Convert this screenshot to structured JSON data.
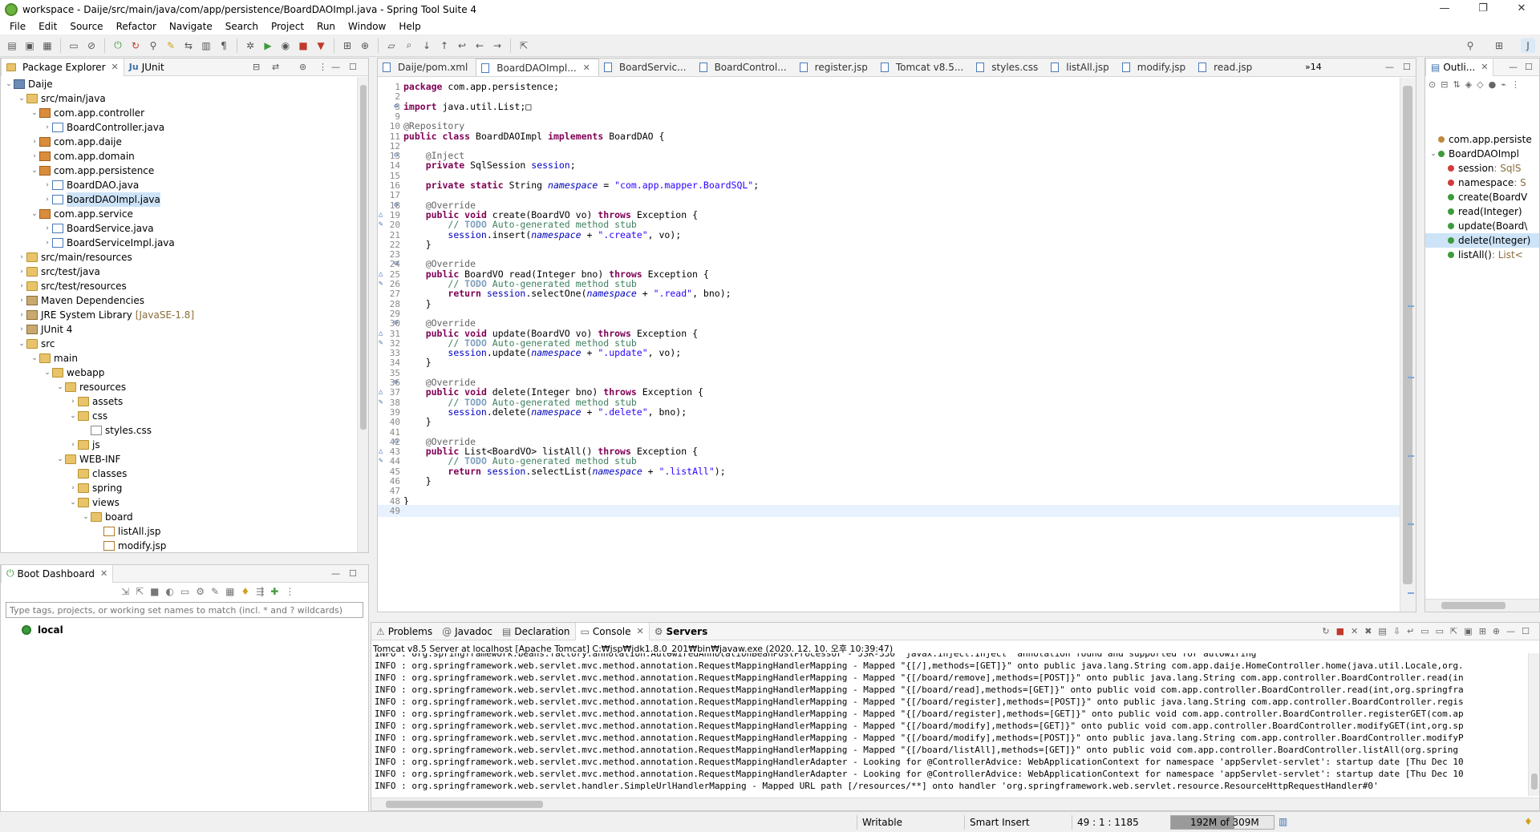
{
  "window": {
    "title": "workspace - Daije/src/main/java/com/app/persistence/BoardDAOImpl.java - Spring Tool Suite 4"
  },
  "menu": [
    "File",
    "Edit",
    "Source",
    "Refactor",
    "Navigate",
    "Search",
    "Project",
    "Run",
    "Window",
    "Help"
  ],
  "package_explorer": {
    "tab_label": "Package Explorer",
    "junit_tab": "JUnit",
    "items": [
      {
        "label": "Daije",
        "indent": 0,
        "arrow": "⌄",
        "icon": "proj"
      },
      {
        "label": "src/main/java",
        "indent": 1,
        "arrow": "⌄",
        "icon": "folder"
      },
      {
        "label": "com.app.controller",
        "indent": 2,
        "arrow": "⌄",
        "icon": "pkg"
      },
      {
        "label": "BoardController.java",
        "indent": 3,
        "arrow": "›",
        "icon": "java"
      },
      {
        "label": "com.app.daije",
        "indent": 2,
        "arrow": "›",
        "icon": "pkg"
      },
      {
        "label": "com.app.domain",
        "indent": 2,
        "arrow": "›",
        "icon": "pkg"
      },
      {
        "label": "com.app.persistence",
        "indent": 2,
        "arrow": "⌄",
        "icon": "pkg"
      },
      {
        "label": "BoardDAO.java",
        "indent": 3,
        "arrow": "›",
        "icon": "java"
      },
      {
        "label": "BoardDAOImpl.java",
        "indent": 3,
        "arrow": "›",
        "icon": "java",
        "selected": true
      },
      {
        "label": "com.app.service",
        "indent": 2,
        "arrow": "⌄",
        "icon": "pkg"
      },
      {
        "label": "BoardService.java",
        "indent": 3,
        "arrow": "›",
        "icon": "java"
      },
      {
        "label": "BoardServiceImpl.java",
        "indent": 3,
        "arrow": "›",
        "icon": "java"
      },
      {
        "label": "src/main/resources",
        "indent": 1,
        "arrow": "›",
        "icon": "folder"
      },
      {
        "label": "src/test/java",
        "indent": 1,
        "arrow": "›",
        "icon": "folder"
      },
      {
        "label": "src/test/resources",
        "indent": 1,
        "arrow": "›",
        "icon": "folder"
      },
      {
        "label": "Maven Dependencies",
        "indent": 1,
        "arrow": "›",
        "icon": "jar"
      },
      {
        "label": "JRE System Library",
        "decoration": "[JavaSE-1.8]",
        "indent": 1,
        "arrow": "›",
        "icon": "jar"
      },
      {
        "label": "JUnit 4",
        "indent": 1,
        "arrow": "›",
        "icon": "jar"
      },
      {
        "label": "src",
        "indent": 1,
        "arrow": "⌄",
        "icon": "folder"
      },
      {
        "label": "main",
        "indent": 2,
        "arrow": "⌄",
        "icon": "folder"
      },
      {
        "label": "webapp",
        "indent": 3,
        "arrow": "⌄",
        "icon": "folder"
      },
      {
        "label": "resources",
        "indent": 4,
        "arrow": "⌄",
        "icon": "folder"
      },
      {
        "label": "assets",
        "indent": 5,
        "arrow": "›",
        "icon": "folder"
      },
      {
        "label": "css",
        "indent": 5,
        "arrow": "⌄",
        "icon": "folder"
      },
      {
        "label": "styles.css",
        "indent": 6,
        "arrow": "",
        "icon": "css"
      },
      {
        "label": "js",
        "indent": 5,
        "arrow": "›",
        "icon": "folder"
      },
      {
        "label": "WEB-INF",
        "indent": 4,
        "arrow": "⌄",
        "icon": "folder"
      },
      {
        "label": "classes",
        "indent": 5,
        "arrow": "",
        "icon": "folder"
      },
      {
        "label": "spring",
        "indent": 5,
        "arrow": "›",
        "icon": "folder"
      },
      {
        "label": "views",
        "indent": 5,
        "arrow": "⌄",
        "icon": "folder"
      },
      {
        "label": "board",
        "indent": 6,
        "arrow": "⌄",
        "icon": "folder"
      },
      {
        "label": "listAll.jsp",
        "indent": 7,
        "arrow": "",
        "icon": "jsp"
      },
      {
        "label": "modify.jsp",
        "indent": 7,
        "arrow": "",
        "icon": "jsp"
      }
    ]
  },
  "editor": {
    "tabs": [
      {
        "label": "Daije/pom.xml",
        "active": false
      },
      {
        "label": "BoardDAOImpl...",
        "active": true
      },
      {
        "label": "BoardServic...",
        "active": false
      },
      {
        "label": "BoardControl...",
        "active": false
      },
      {
        "label": "register.jsp",
        "active": false
      },
      {
        "label": "Tomcat v8.5...",
        "active": false
      },
      {
        "label": "styles.css",
        "active": false
      },
      {
        "label": "listAll.jsp",
        "active": false
      },
      {
        "label": "modify.jsp",
        "active": false
      },
      {
        "label": "read.jsp",
        "active": false
      }
    ],
    "overflow": "»14",
    "lines": [
      {
        "n": "1",
        "html": "<span class='kw'>package</span> com.app.persistence;"
      },
      {
        "n": "2",
        "html": ""
      },
      {
        "n": "3",
        "html": "<span class='kw'>import</span> java.util.List;&#9633;",
        "mark": "⊕"
      },
      {
        "n": "9",
        "html": ""
      },
      {
        "n": "10",
        "html": "<span class='ann'>@Repository</span>"
      },
      {
        "n": "11",
        "html": "<span class='kw'>public class</span> BoardDAOImpl <span class='kw'>implements</span> BoardDAO {"
      },
      {
        "n": "12",
        "html": ""
      },
      {
        "n": "13",
        "html": "    <span class='ann'>@Inject</span>",
        "mark": "⊖"
      },
      {
        "n": "14",
        "html": "    <span class='kw'>private</span> SqlSession <span class='fld'>session</span>;"
      },
      {
        "n": "15",
        "html": ""
      },
      {
        "n": "16",
        "html": "    <span class='kw'>private static</span> String <span class='sfld'>namespace</span> = <span class='str'>\"com.app.mapper.BoardSQL\"</span>;"
      },
      {
        "n": "17",
        "html": ""
      },
      {
        "n": "18",
        "html": "    <span class='ann'>@Override</span>",
        "mark": "⊖"
      },
      {
        "n": "19",
        "html": "    <span class='kw'>public void</span> create(BoardVO vo) <span class='kw'>throws</span> Exception {",
        "mark": "△"
      },
      {
        "n": "20",
        "html": "        <span class='cmt'>// <span class='todo'>TODO</span> Auto-generated method stub</span>",
        "mark": "✎"
      },
      {
        "n": "21",
        "html": "        <span class='fld'>session</span>.insert(<span class='sfld'>namespace</span> + <span class='str'>\".create\"</span>, vo);"
      },
      {
        "n": "22",
        "html": "    }"
      },
      {
        "n": "23",
        "html": ""
      },
      {
        "n": "24",
        "html": "    <span class='ann'>@Override</span>",
        "mark": "⊖"
      },
      {
        "n": "25",
        "html": "    <span class='kw'>public</span> BoardVO read(Integer bno) <span class='kw'>throws</span> Exception {",
        "mark": "△"
      },
      {
        "n": "26",
        "html": "        <span class='cmt'>// <span class='todo'>TODO</span> Auto-generated method stub</span>",
        "mark": "✎"
      },
      {
        "n": "27",
        "html": "        <span class='kw'>return</span> <span class='fld'>session</span>.selectOne(<span class='sfld'>namespace</span> + <span class='str'>\".read\"</span>, bno);"
      },
      {
        "n": "28",
        "html": "    }"
      },
      {
        "n": "29",
        "html": ""
      },
      {
        "n": "30",
        "html": "    <span class='ann'>@Override</span>",
        "mark": "⊖"
      },
      {
        "n": "31",
        "html": "    <span class='kw'>public void</span> update(BoardVO vo) <span class='kw'>throws</span> Exception {",
        "mark": "△"
      },
      {
        "n": "32",
        "html": "        <span class='cmt'>// <span class='todo'>TODO</span> Auto-generated method stub</span>",
        "mark": "✎"
      },
      {
        "n": "33",
        "html": "        <span class='fld'>session</span>.update(<span class='sfld'>namespace</span> + <span class='str'>\".update\"</span>, vo);"
      },
      {
        "n": "34",
        "html": "    }"
      },
      {
        "n": "35",
        "html": ""
      },
      {
        "n": "36",
        "html": "    <span class='ann'>@Override</span>",
        "mark": "⊖"
      },
      {
        "n": "37",
        "html": "    <span class='kw'>public void</span> delete(Integer bno) <span class='kw'>throws</span> Exception {",
        "mark": "△"
      },
      {
        "n": "38",
        "html": "        <span class='cmt'>// <span class='todo'>TODO</span> Auto-generated method stub</span>",
        "mark": "✎"
      },
      {
        "n": "39",
        "html": "        <span class='fld'>session</span>.delete(<span class='sfld'>namespace</span> + <span class='str'>\".delete\"</span>, bno);"
      },
      {
        "n": "40",
        "html": "    }"
      },
      {
        "n": "41",
        "html": ""
      },
      {
        "n": "42",
        "html": "    <span class='ann'>@Override</span>",
        "mark": "⊖"
      },
      {
        "n": "43",
        "html": "    <span class='kw'>public</span> List&lt;BoardVO&gt; listAll() <span class='kw'>throws</span> Exception {",
        "mark": "△"
      },
      {
        "n": "44",
        "html": "        <span class='cmt'>// <span class='todo'>TODO</span> Auto-generated method stub</span>",
        "mark": "✎"
      },
      {
        "n": "45",
        "html": "        <span class='kw'>return</span> <span class='fld'>session</span>.selectList(<span class='sfld'>namespace</span> + <span class='str'>\".listAll\"</span>);"
      },
      {
        "n": "46",
        "html": "    }"
      },
      {
        "n": "47",
        "html": ""
      },
      {
        "n": "48",
        "html": "}"
      },
      {
        "n": "49",
        "html": "",
        "current": true
      }
    ]
  },
  "outline": {
    "tab_label": "Outli...",
    "items": [
      {
        "label": "com.app.persiste",
        "color": "#c08a3e",
        "indent": 0
      },
      {
        "label": "BoardDAOImpl",
        "color": "#3d9b3d",
        "indent": 0,
        "arrow": "⌄"
      },
      {
        "label": "session",
        "suffix": " : SqlS",
        "color": "#d23c3c",
        "indent": 1
      },
      {
        "label": "namespace",
        "suffix": " : S",
        "color": "#d23c3c",
        "indent": 1
      },
      {
        "label": "create(BoardV",
        "color": "#3d9b3d",
        "indent": 1
      },
      {
        "label": "read(Integer)",
        "color": "#3d9b3d",
        "indent": 1
      },
      {
        "label": "update(Board\\",
        "color": "#3d9b3d",
        "indent": 1
      },
      {
        "label": "delete(Integer)",
        "color": "#3d9b3d",
        "indent": 1,
        "selected": true
      },
      {
        "label": "listAll()",
        "suffix": " : List<",
        "color": "#3d9b3d",
        "indent": 1
      }
    ]
  },
  "boot_dashboard": {
    "tab_label": "Boot Dashboard",
    "filter_placeholder": "Type tags, projects, or working set names to match (incl. * and ? wildcards)",
    "items": [
      "local"
    ]
  },
  "console": {
    "tabs": [
      "Problems",
      "Javadoc",
      "Declaration",
      "Console",
      "Servers"
    ],
    "active_tab": "Console",
    "header": "Tomcat v8.5 Server at localhost [Apache Tomcat] C:₩jsp₩jdk1.8.0_201₩bin₩javaw.exe  (2020. 12. 10. 오후 10:39:47)",
    "lines": [
      "INFO : org.springframework.beans.factory.annotation.AutowiredAnnotationBeanPostProcessor - JSR-330 'javax.inject.Inject' annotation found and supported for autowiring",
      "INFO : org.springframework.web.servlet.mvc.method.annotation.RequestMappingHandlerMapping - Mapped \"{[/],methods=[GET]}\" onto public java.lang.String com.app.daije.HomeController.home(java.util.Locale,org.",
      "INFO : org.springframework.web.servlet.mvc.method.annotation.RequestMappingHandlerMapping - Mapped \"{[/board/remove],methods=[POST]}\" onto public java.lang.String com.app.controller.BoardController.read(in",
      "INFO : org.springframework.web.servlet.mvc.method.annotation.RequestMappingHandlerMapping - Mapped \"{[/board/read],methods=[GET]}\" onto public void com.app.controller.BoardController.read(int,org.springfra",
      "INFO : org.springframework.web.servlet.mvc.method.annotation.RequestMappingHandlerMapping - Mapped \"{[/board/register],methods=[POST]}\" onto public java.lang.String com.app.controller.BoardController.regis",
      "INFO : org.springframework.web.servlet.mvc.method.annotation.RequestMappingHandlerMapping - Mapped \"{[/board/register],methods=[GET]}\" onto public void com.app.controller.BoardController.registerGET(com.ap",
      "INFO : org.springframework.web.servlet.mvc.method.annotation.RequestMappingHandlerMapping - Mapped \"{[/board/modify],methods=[GET]}\" onto public void com.app.controller.BoardController.modifyGET(int,org.sp",
      "INFO : org.springframework.web.servlet.mvc.method.annotation.RequestMappingHandlerMapping - Mapped \"{[/board/modify],methods=[POST]}\" onto public java.lang.String com.app.controller.BoardController.modifyP",
      "INFO : org.springframework.web.servlet.mvc.method.annotation.RequestMappingHandlerMapping - Mapped \"{[/board/listAll],methods=[GET]}\" onto public void com.app.controller.BoardController.listAll(org.spring",
      "INFO : org.springframework.web.servlet.mvc.method.annotation.RequestMappingHandlerAdapter - Looking for @ControllerAdvice: WebApplicationContext for namespace 'appServlet-servlet': startup date [Thu Dec 10",
      "INFO : org.springframework.web.servlet.mvc.method.annotation.RequestMappingHandlerAdapter - Looking for @ControllerAdvice: WebApplicationContext for namespace 'appServlet-servlet': startup date [Thu Dec 10",
      "INFO : org.springframework.web.servlet.handler.SimpleUrlHandlerMapping - Mapped URL path [/resources/**] onto handler 'org.springframework.web.servlet.resource.ResourceHttpRequestHandler#0'"
    ]
  },
  "status": {
    "writable": "Writable",
    "insert_mode": "Smart Insert",
    "position": "49 : 1 : 1185",
    "heap": "192M of 309M",
    "heap_fraction": 0.62
  },
  "colors": {
    "selection": "#cde3f7",
    "accent": "#6db33f"
  }
}
